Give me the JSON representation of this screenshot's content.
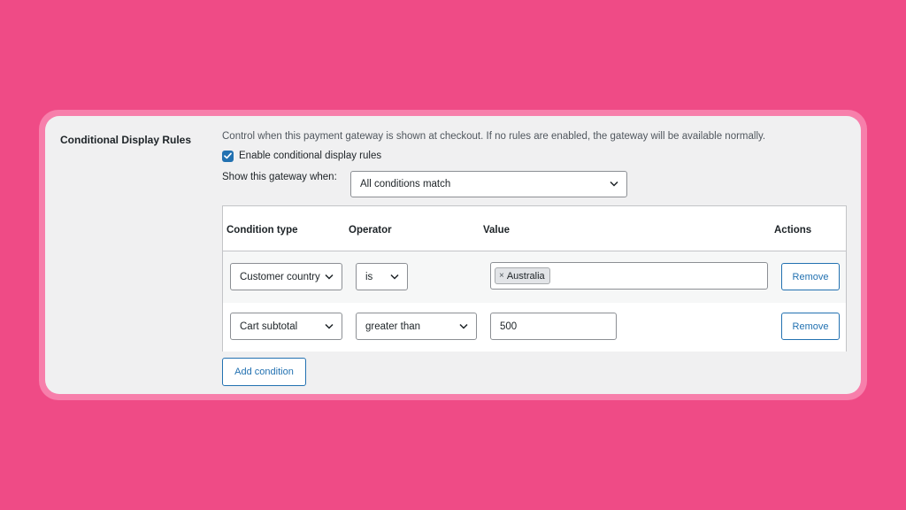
{
  "section": {
    "label": "Conditional Display Rules",
    "description": "Control when this payment gateway is shown at checkout. If no rules are enabled, the gateway will be available normally."
  },
  "enable": {
    "label": "Enable conditional display rules",
    "checked": true
  },
  "match": {
    "label": "Show this gateway when:",
    "selected": "All conditions match"
  },
  "table": {
    "headers": {
      "type": "Condition type",
      "operator": "Operator",
      "value": "Value",
      "actions": "Actions"
    },
    "rows": [
      {
        "type": "Customer country",
        "operator": "is",
        "tokens": [
          "Australia"
        ],
        "value": "",
        "remove": "Remove"
      },
      {
        "type": "Cart subtotal",
        "operator": "greater than",
        "tokens": [],
        "value": "500",
        "remove": "Remove"
      }
    ]
  },
  "add_condition": "Add condition",
  "colors": {
    "background": "#ef4b86",
    "card": "#f0f0f1",
    "accent": "#2271b1"
  }
}
